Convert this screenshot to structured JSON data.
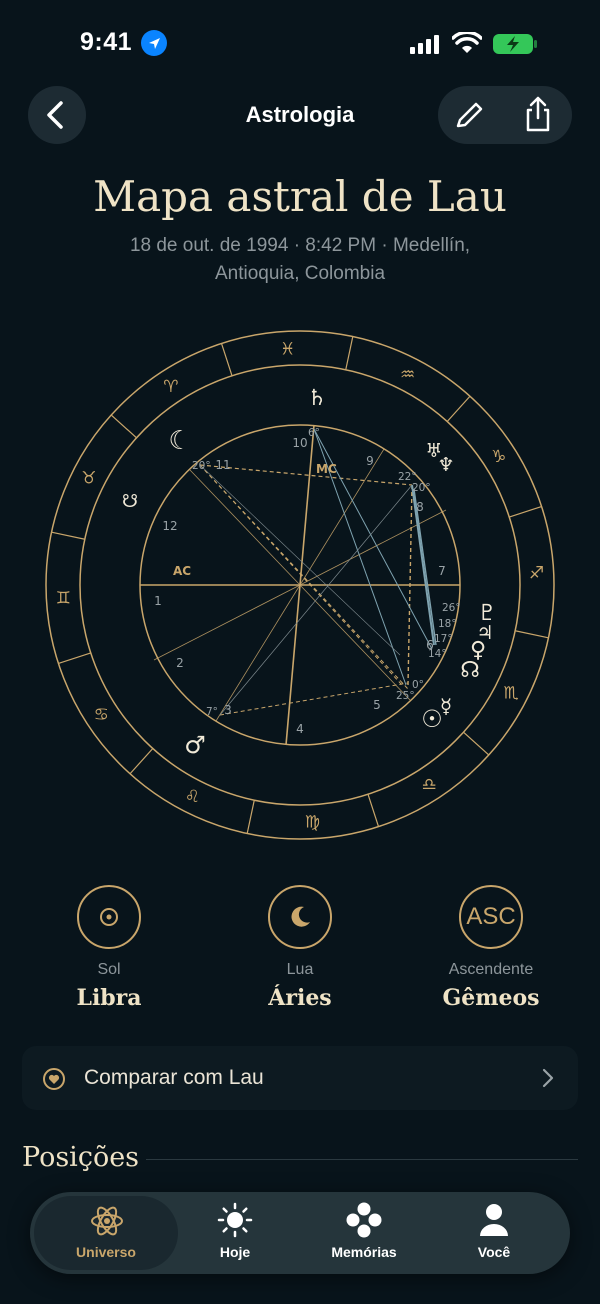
{
  "status": {
    "time": "9:41"
  },
  "nav": {
    "title": "Astrologia",
    "back_icon": "chevron-left-icon",
    "edit_icon": "pencil-icon",
    "share_icon": "share-icon"
  },
  "header": {
    "title": "Mapa astral de Lau",
    "subtitle_line1": "18 de out. de 1994 · 8:42 PM · Medellín,",
    "subtitle_line2": "Antioquia, Colombia"
  },
  "chart": {
    "zodiac_signs": [
      "♓",
      "♒",
      "♑",
      "♐",
      "♏",
      "♎",
      "♍",
      "♌",
      "♋",
      "♊",
      "♉",
      "♈"
    ],
    "house_numbers": [
      "1",
      "2",
      "3",
      "4",
      "5",
      "6",
      "7",
      "8",
      "9",
      "10",
      "11",
      "12"
    ],
    "angle_labels": {
      "ac": "AC",
      "mc": "MC"
    },
    "degree_labels": [
      "6°",
      "20°",
      "22°",
      "20°",
      "26°",
      "18°",
      "17°",
      "14°",
      "0°",
      "25°",
      "7°"
    ],
    "planets": {
      "moon": "☾",
      "saturn": "♄",
      "uranus": "♅",
      "neptune": "♆",
      "pluto": "♇",
      "jupiter": "♃",
      "venus": "♀",
      "node": "☊",
      "south_node": "☋",
      "sun": "☉",
      "mercury": "☿",
      "mars": "♂"
    },
    "accent_color": "#c9a66b",
    "aspect_blue": "#7fa3b0"
  },
  "big_three": [
    {
      "label": "Sol",
      "value": "Libra",
      "icon": "sun-icon"
    },
    {
      "label": "Lua",
      "value": "Áries",
      "icon": "moon-icon"
    },
    {
      "label": "Ascendente",
      "value": "Gêmeos",
      "icon_text": "ASC"
    }
  ],
  "compare": {
    "label": "Comparar com Lau"
  },
  "positions": {
    "title": "Posições"
  },
  "tabs": [
    {
      "label": "Universo",
      "active": true
    },
    {
      "label": "Hoje"
    },
    {
      "label": "Memórias"
    },
    {
      "label": "Você"
    }
  ]
}
